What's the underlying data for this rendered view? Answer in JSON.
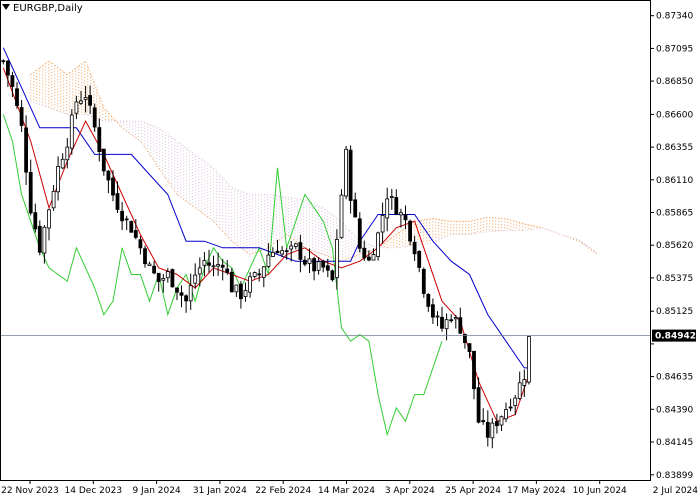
{
  "chart_data": {
    "type": "candlestick",
    "title": "EURGBP,Daily",
    "current_price_label": "0.84942",
    "ylim": [
      0.8386,
      0.8745
    ],
    "y_ticks": [
      "0.87340",
      "0.87095",
      "0.86850",
      "0.86600",
      "0.86355",
      "0.86110",
      "0.85865",
      "0.85620",
      "0.85375",
      "0.85125",
      "0.84880",
      "0.84635",
      "0.84390",
      "0.84145",
      "0.83899"
    ],
    "x_ticks": [
      "22 Nov 2023",
      "14 Dec 2023",
      "9 Jan 2024",
      "31 Jan 2024",
      "22 Feb 2024",
      "14 Mar 2024",
      "3 Apr 2024",
      "25 Apr 2024",
      "17 May 2024",
      "10 Jun 2024",
      "2 Jul 2024"
    ],
    "close_path": [
      [
        0,
        0.87
      ],
      [
        2,
        0.868
      ],
      [
        4,
        0.865
      ],
      [
        6,
        0.859
      ],
      [
        8,
        0.856
      ],
      [
        10,
        0.859
      ],
      [
        12,
        0.862
      ],
      [
        14,
        0.864
      ],
      [
        16,
        0.867
      ],
      [
        18,
        0.8675
      ],
      [
        20,
        0.865
      ],
      [
        22,
        0.862
      ],
      [
        24,
        0.86
      ],
      [
        26,
        0.8585
      ],
      [
        28,
        0.8575
      ],
      [
        30,
        0.856
      ],
      [
        32,
        0.8545
      ],
      [
        34,
        0.8535
      ],
      [
        36,
        0.854
      ],
      [
        38,
        0.853
      ],
      [
        40,
        0.852
      ],
      [
        42,
        0.854
      ],
      [
        44,
        0.855
      ],
      [
        46,
        0.8545
      ],
      [
        48,
        0.855
      ],
      [
        50,
        0.853
      ],
      [
        52,
        0.8525
      ],
      [
        54,
        0.8535
      ],
      [
        56,
        0.854
      ],
      [
        58,
        0.8555
      ],
      [
        60,
        0.856
      ],
      [
        62,
        0.8555
      ],
      [
        64,
        0.856
      ],
      [
        66,
        0.855
      ],
      [
        68,
        0.8545
      ],
      [
        70,
        0.8545
      ],
      [
        72,
        0.8535
      ],
      [
        74,
        0.86
      ],
      [
        75,
        0.863
      ],
      [
        76,
        0.86
      ],
      [
        78,
        0.856
      ],
      [
        80,
        0.855
      ],
      [
        82,
        0.857
      ],
      [
        84,
        0.86
      ],
      [
        86,
        0.859
      ],
      [
        88,
        0.858
      ],
      [
        90,
        0.856
      ],
      [
        92,
        0.853
      ],
      [
        94,
        0.851
      ],
      [
        96,
        0.85
      ],
      [
        98,
        0.851
      ],
      [
        100,
        0.85
      ],
      [
        102,
        0.848
      ],
      [
        104,
        0.843
      ],
      [
        106,
        0.842
      ],
      [
        108,
        0.843
      ],
      [
        110,
        0.844
      ],
      [
        112,
        0.845
      ],
      [
        114,
        0.8465
      ],
      [
        115,
        0.8492
      ]
    ],
    "tenkan_path": [
      [
        0,
        0.8695
      ],
      [
        6,
        0.864
      ],
      [
        10,
        0.859
      ],
      [
        14,
        0.8625
      ],
      [
        18,
        0.8655
      ],
      [
        22,
        0.863
      ],
      [
        26,
        0.86
      ],
      [
        30,
        0.857
      ],
      [
        34,
        0.8545
      ],
      [
        38,
        0.854
      ],
      [
        42,
        0.853
      ],
      [
        46,
        0.8545
      ],
      [
        50,
        0.854
      ],
      [
        54,
        0.8535
      ],
      [
        58,
        0.854
      ],
      [
        62,
        0.8555
      ],
      [
        66,
        0.856
      ],
      [
        70,
        0.855
      ],
      [
        74,
        0.8545
      ],
      [
        78,
        0.855
      ],
      [
        82,
        0.856
      ],
      [
        86,
        0.8575
      ],
      [
        90,
        0.858
      ],
      [
        92,
        0.856
      ],
      [
        96,
        0.852
      ],
      [
        100,
        0.8505
      ],
      [
        104,
        0.846
      ],
      [
        108,
        0.843
      ],
      [
        112,
        0.8435
      ],
      [
        115,
        0.8465
      ]
    ],
    "kijun_path": [
      [
        0,
        0.871
      ],
      [
        4,
        0.868
      ],
      [
        8,
        0.865
      ],
      [
        12,
        0.865
      ],
      [
        16,
        0.865
      ],
      [
        20,
        0.863
      ],
      [
        24,
        0.863
      ],
      [
        28,
        0.863
      ],
      [
        32,
        0.8615
      ],
      [
        36,
        0.86
      ],
      [
        40,
        0.8565
      ],
      [
        44,
        0.8565
      ],
      [
        48,
        0.856
      ],
      [
        52,
        0.856
      ],
      [
        56,
        0.856
      ],
      [
        60,
        0.8555
      ],
      [
        64,
        0.855
      ],
      [
        68,
        0.855
      ],
      [
        72,
        0.855
      ],
      [
        76,
        0.855
      ],
      [
        78,
        0.8565
      ],
      [
        82,
        0.8585
      ],
      [
        86,
        0.8585
      ],
      [
        90,
        0.8585
      ],
      [
        94,
        0.8565
      ],
      [
        98,
        0.855
      ],
      [
        102,
        0.854
      ],
      [
        106,
        0.851
      ],
      [
        110,
        0.849
      ],
      [
        114,
        0.847
      ],
      [
        115,
        0.847
      ]
    ],
    "chikou_path": [
      [
        0,
        0.866
      ],
      [
        2,
        0.864
      ],
      [
        4,
        0.86
      ],
      [
        6,
        0.858
      ],
      [
        8,
        0.856
      ],
      [
        10,
        0.8545
      ],
      [
        12,
        0.854
      ],
      [
        14,
        0.8535
      ],
      [
        16,
        0.856
      ],
      [
        18,
        0.8545
      ],
      [
        20,
        0.853
      ],
      [
        22,
        0.851
      ],
      [
        24,
        0.852
      ],
      [
        26,
        0.856
      ],
      [
        28,
        0.854
      ],
      [
        30,
        0.854
      ],
      [
        32,
        0.852
      ],
      [
        34,
        0.854
      ],
      [
        36,
        0.851
      ],
      [
        38,
        0.853
      ],
      [
        40,
        0.854
      ],
      [
        42,
        0.852
      ],
      [
        44,
        0.8545
      ],
      [
        46,
        0.856
      ],
      [
        48,
        0.855
      ],
      [
        50,
        0.8545
      ],
      [
        52,
        0.853
      ],
      [
        54,
        0.8545
      ],
      [
        56,
        0.856
      ],
      [
        58,
        0.854
      ],
      [
        60,
        0.862
      ],
      [
        62,
        0.856
      ],
      [
        64,
        0.858
      ],
      [
        66,
        0.86
      ],
      [
        68,
        0.859
      ],
      [
        70,
        0.858
      ],
      [
        72,
        0.856
      ],
      [
        74,
        0.85
      ],
      [
        76,
        0.849
      ],
      [
        78,
        0.8495
      ],
      [
        80,
        0.849
      ],
      [
        82,
        0.845
      ],
      [
        84,
        0.842
      ],
      [
        86,
        0.844
      ],
      [
        88,
        0.843
      ],
      [
        90,
        0.845
      ],
      [
        92,
        0.845
      ],
      [
        94,
        0.847
      ],
      [
        96,
        0.849
      ]
    ],
    "span_a_path": [
      [
        6,
        0.869
      ],
      [
        10,
        0.87
      ],
      [
        14,
        0.869
      ],
      [
        18,
        0.87
      ],
      [
        22,
        0.8665
      ],
      [
        26,
        0.865
      ],
      [
        30,
        0.864
      ],
      [
        34,
        0.862
      ],
      [
        38,
        0.86
      ],
      [
        42,
        0.859
      ],
      [
        46,
        0.858
      ],
      [
        50,
        0.8565
      ],
      [
        54,
        0.8555
      ],
      [
        58,
        0.856
      ],
      [
        62,
        0.857
      ],
      [
        66,
        0.856
      ],
      [
        70,
        0.8555
      ],
      [
        74,
        0.855
      ],
      [
        78,
        0.8555
      ],
      [
        82,
        0.856
      ],
      [
        86,
        0.857
      ],
      [
        90,
        0.858
      ],
      [
        94,
        0.8582
      ],
      [
        98,
        0.858
      ],
      [
        102,
        0.858
      ],
      [
        106,
        0.8583
      ],
      [
        110,
        0.8582
      ],
      [
        114,
        0.8578
      ],
      [
        118,
        0.8575
      ],
      [
        122,
        0.857
      ],
      [
        126,
        0.8565
      ],
      [
        130,
        0.8555
      ]
    ],
    "span_b_path": [
      [
        6,
        0.867
      ],
      [
        10,
        0.8665
      ],
      [
        14,
        0.866
      ],
      [
        18,
        0.866
      ],
      [
        22,
        0.8655
      ],
      [
        26,
        0.8655
      ],
      [
        30,
        0.8655
      ],
      [
        34,
        0.865
      ],
      [
        38,
        0.864
      ],
      [
        42,
        0.863
      ],
      [
        46,
        0.862
      ],
      [
        50,
        0.8605
      ],
      [
        54,
        0.86
      ],
      [
        58,
        0.86
      ],
      [
        62,
        0.8598
      ],
      [
        66,
        0.8596
      ],
      [
        70,
        0.859
      ],
      [
        74,
        0.858
      ],
      [
        78,
        0.8565
      ],
      [
        82,
        0.856
      ],
      [
        86,
        0.856
      ],
      [
        90,
        0.8562
      ],
      [
        94,
        0.8564
      ],
      [
        98,
        0.857
      ],
      [
        102,
        0.857
      ],
      [
        106,
        0.8572
      ],
      [
        110,
        0.8573
      ],
      [
        114,
        0.8573
      ],
      [
        118,
        0.8575
      ],
      [
        122,
        0.857
      ],
      [
        126,
        0.8566
      ],
      [
        130,
        0.8556
      ]
    ],
    "candle_count": 116,
    "future_periods": 26,
    "grid": false,
    "legend": "none",
    "colors": {
      "candle": "#000000",
      "tenkan": "#cc0000",
      "kijun": "#0000cc",
      "chikou": "#33cc33",
      "span_a": "#f4a460",
      "span_b": "#d8bfd8",
      "price_line": "#708090",
      "frame": "#000000",
      "background": "#ffffff"
    }
  }
}
